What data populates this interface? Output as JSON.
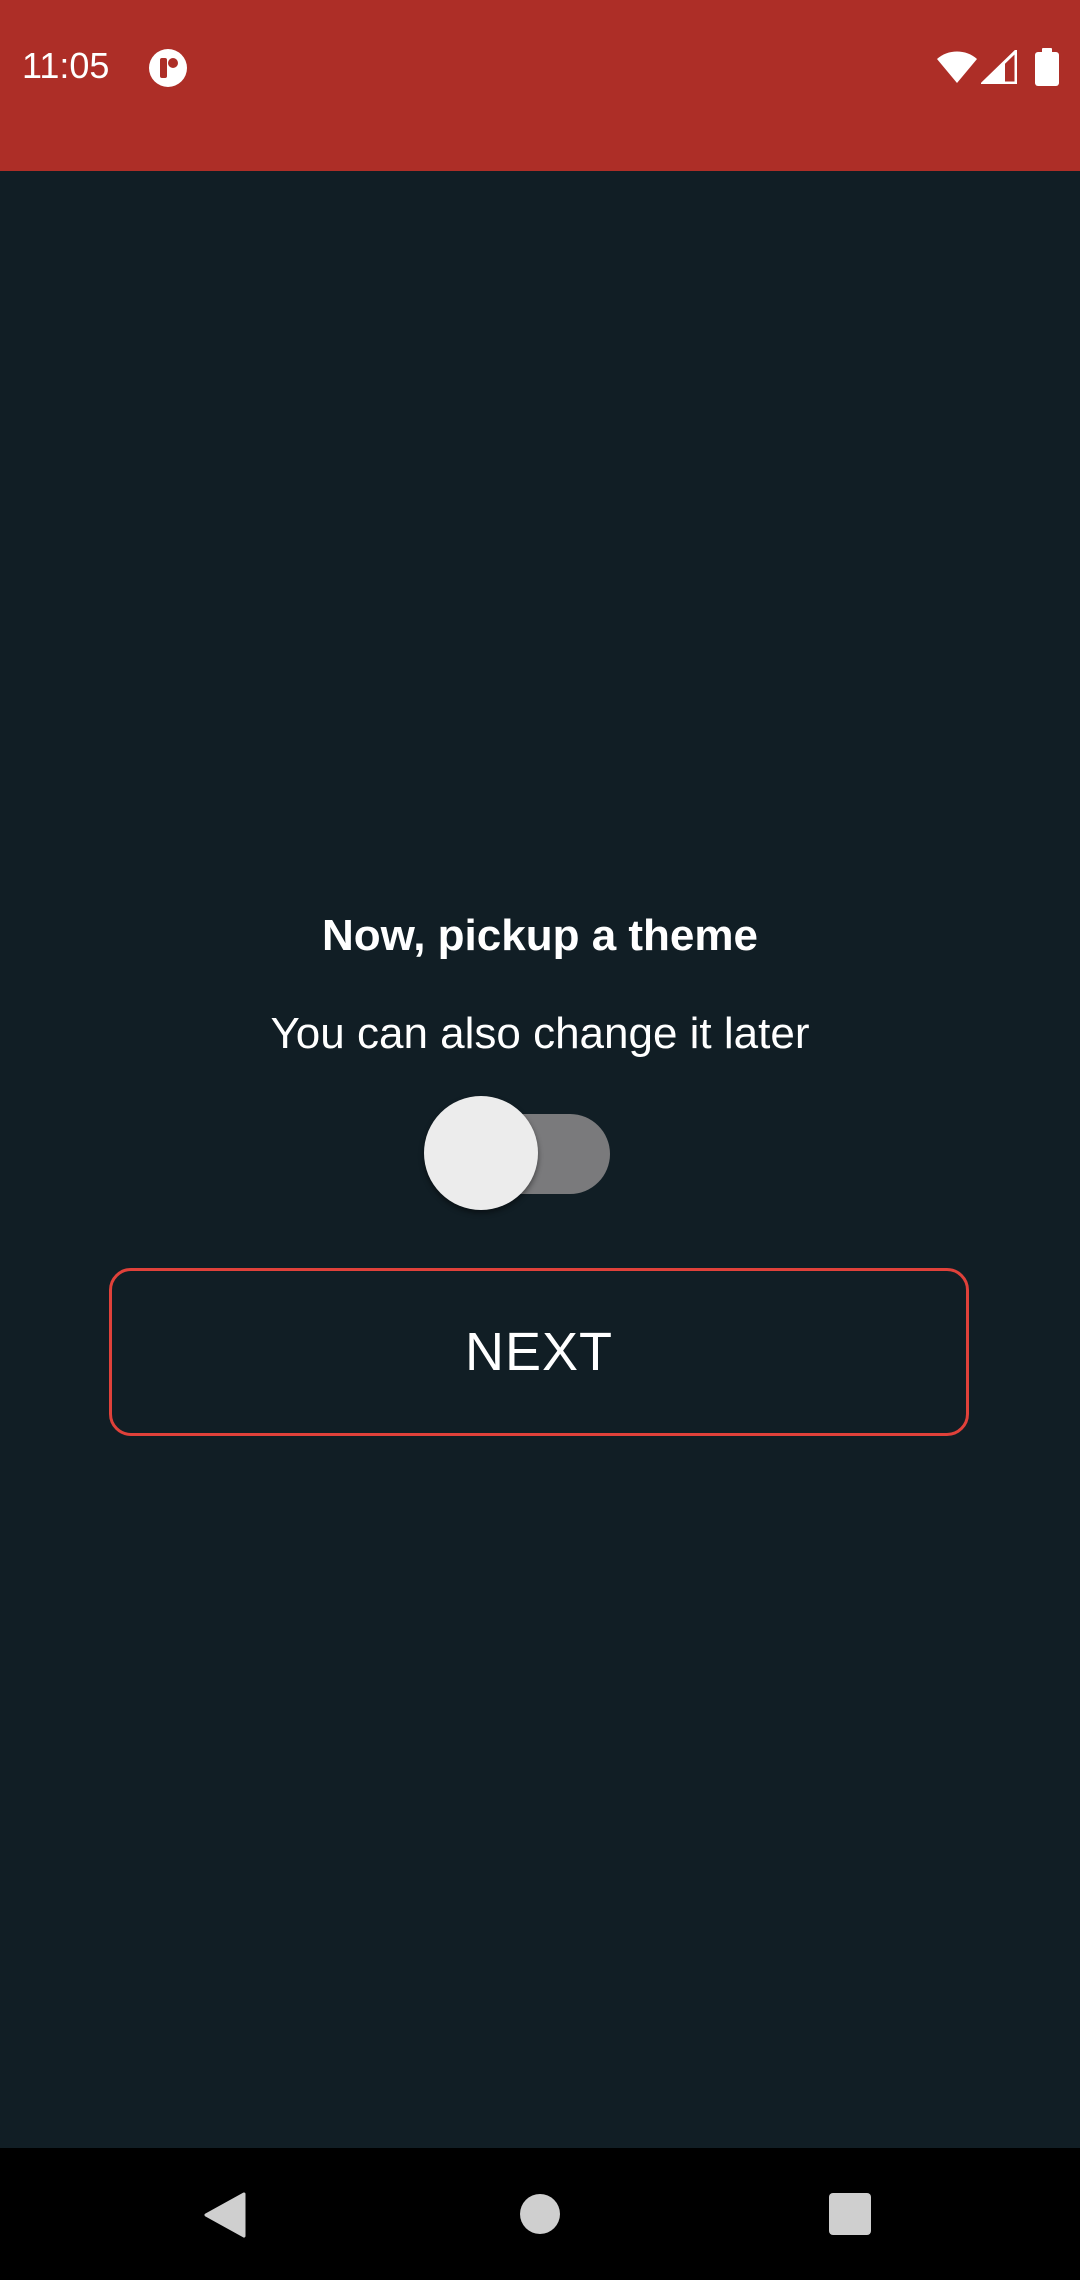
{
  "status_bar": {
    "time": "11:05",
    "app_icon": "app-notification-icon",
    "wifi_icon": "wifi-icon",
    "signal_icon": "cell-signal-icon",
    "battery_icon": "battery-icon",
    "background_color": "#ad2e27"
  },
  "onboarding": {
    "title": "Now, pickup a theme",
    "subtitle": "You can also change it later",
    "theme_switch": {
      "checked": false,
      "track_color": "#7a7a7c",
      "thumb_color": "#ececec"
    },
    "next_label": "NEXT",
    "button_border_color": "#e0413a",
    "background_color": "#111e25"
  },
  "nav_bar": {
    "back_icon": "back-triangle-icon",
    "home_icon": "home-circle-icon",
    "recents_icon": "recents-square-icon"
  }
}
